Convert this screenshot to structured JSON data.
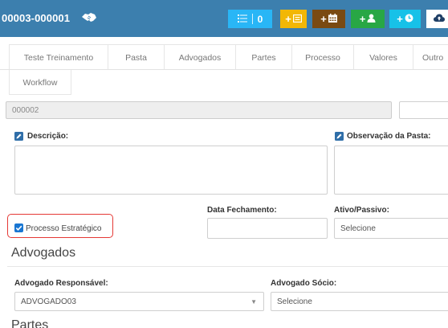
{
  "header": {
    "title": "00003-000001",
    "title_icon": "handshake-icon",
    "buttons": {
      "list_count": "0",
      "list_icon": "list-icon",
      "doc_plus": "+",
      "doc_icon": "document-icon",
      "cal_plus": "+",
      "cal_icon": "calendar-icon",
      "user_plus": "+",
      "user_icon": "user-icon",
      "clock_plus": "+",
      "clock_icon": "clock-icon",
      "cloud_icon": "cloud-upload-icon"
    },
    "colors": {
      "bar": "#3c7fae",
      "list": "#29b6f6",
      "doc": "#f2b705",
      "calendar": "#7a4a12",
      "user": "#28a745",
      "clock": "#17c1e8"
    }
  },
  "tabs": [
    {
      "label": "Teste Treinamento"
    },
    {
      "label": "Pasta"
    },
    {
      "label": "Advogados"
    },
    {
      "label": "Partes"
    },
    {
      "label": "Processo"
    },
    {
      "label": "Valores"
    },
    {
      "label": "Outro"
    },
    {
      "label": "Workflow"
    }
  ],
  "form": {
    "code_value": "000002",
    "descricao_label": "Descrição:",
    "observacao_label": "Observação da Pasta:",
    "data_fechamento_label": "Data Fechamento:",
    "ativo_passivo_label": "Ativo/Passivo:",
    "ativo_passivo_value": "Selecione",
    "processo_estrategico_label": "Processo Estratégico",
    "processo_estrategico_checked": true
  },
  "advogados": {
    "title": "Advogados",
    "responsavel_label": "Advogado Responsável:",
    "responsavel_value": "ADVOGADO03",
    "socio_label": "Advogado Sócio:",
    "socio_value": "Selecione"
  },
  "partes": {
    "title": "Partes"
  }
}
